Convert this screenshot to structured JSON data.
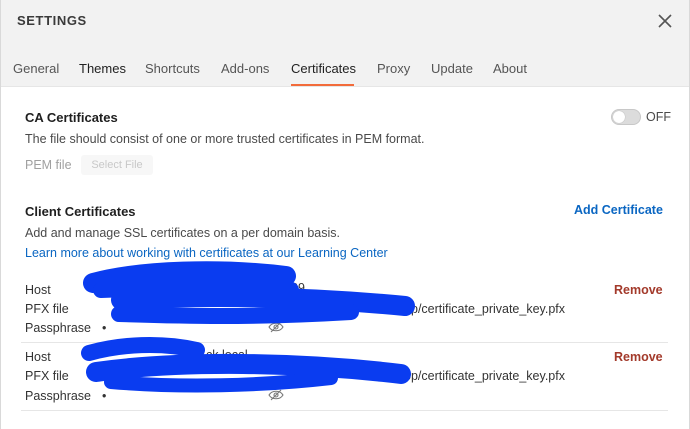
{
  "header": {
    "title": "SETTINGS"
  },
  "tabs": [
    {
      "label": "General"
    },
    {
      "label": "Themes"
    },
    {
      "label": "Shortcuts"
    },
    {
      "label": "Add-ons"
    },
    {
      "label": "Certificates",
      "active": true
    },
    {
      "label": "Proxy"
    },
    {
      "label": "Update"
    },
    {
      "label": "About"
    }
  ],
  "ca": {
    "title": "CA Certificates",
    "toggle_state": "OFF",
    "description": "The file should consist of one or more trusted certificates in PEM format.",
    "pem_label": "PEM file",
    "select_file_label": "Select File"
  },
  "client": {
    "title": "Client Certificates",
    "add_label": "Add Certificate",
    "description": "Add and manage SSL certificates on a per domain basis.",
    "learn_link": "Learn more about working with certificates at our Learning Center",
    "labels": {
      "host": "Host",
      "pfx": "PFX file",
      "passphrase": "Passphrase",
      "remove": "Remove"
    },
    "entries": [
      {
        "host_visible": "39",
        "pfx_visible": "p/certificate_private_key.pfx",
        "passphrase": "•"
      },
      {
        "host_visible": "ck.local",
        "pfx_visible": "pp/certificate_private_key.pfx",
        "passphrase": "•"
      }
    ]
  },
  "colors": {
    "accent": "#f26b3a",
    "link": "#0a66c2",
    "remove": "#a33a2b",
    "redaction": "#0a3cf0"
  }
}
